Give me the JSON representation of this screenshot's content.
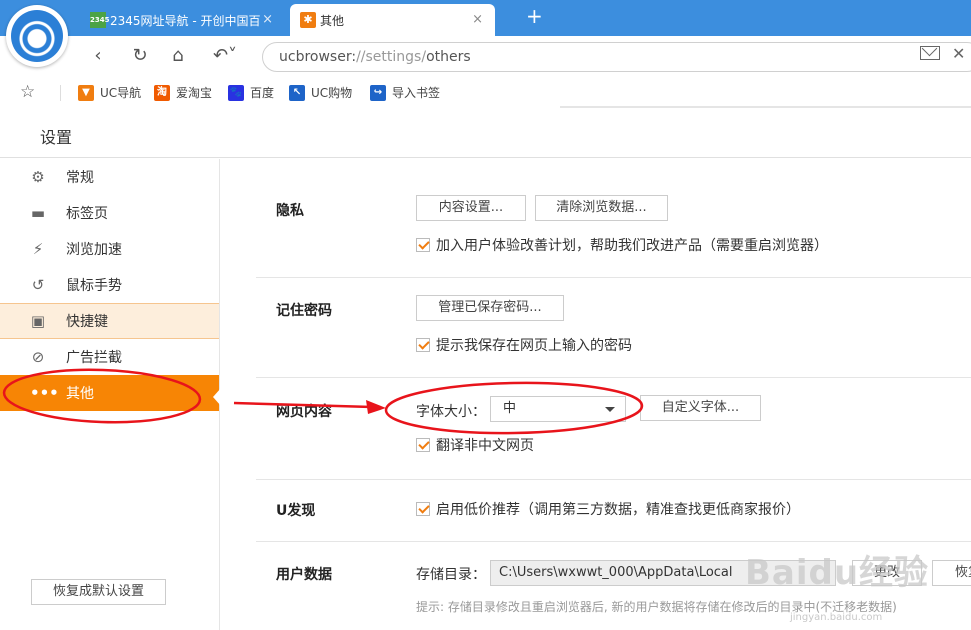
{
  "tabs": [
    {
      "label": "2345网址导航 - 开创中国百",
      "favicon": "2345-icon",
      "favicon_text": "2345"
    },
    {
      "label": "其他",
      "favicon": "gear-icon"
    }
  ],
  "tab_close": "×",
  "new_tab": "+",
  "address": {
    "scheme": "ucbrowser:",
    "sep1": "//",
    "host": "settings",
    "sep2": "/",
    "path": "others"
  },
  "bookmarks": [
    {
      "label": "UC导航",
      "color": "#f07d10",
      "glyph": "▼"
    },
    {
      "label": "爱淘宝",
      "color": "#f05a00",
      "glyph": "淘"
    },
    {
      "label": "百度",
      "color": "#2932e1",
      "glyph": "🐾"
    },
    {
      "label": "UC购物",
      "color": "#1e64c8",
      "glyph": "↖"
    },
    {
      "label": "导入书签",
      "color": "#1e64c8",
      "glyph": "↪"
    }
  ],
  "settings_title": "设置",
  "sidebar": {
    "items": [
      {
        "label": "常规",
        "icon": "gear-icon",
        "glyph": "⚙"
      },
      {
        "label": "标签页",
        "icon": "tab-icon",
        "glyph": "▬"
      },
      {
        "label": "浏览加速",
        "icon": "lightning-icon",
        "glyph": "⚡"
      },
      {
        "label": "鼠标手势",
        "icon": "mouse-gesture-icon",
        "glyph": "↺"
      },
      {
        "label": "快捷键",
        "icon": "shortcut-icon",
        "glyph": "▣"
      },
      {
        "label": "广告拦截",
        "icon": "block-icon",
        "glyph": "⊘"
      },
      {
        "label": "其他",
        "icon": "more-icon",
        "glyph": "•••"
      }
    ],
    "reset_label": "恢复成默认设置"
  },
  "privacy": {
    "title": "隐私",
    "content_settings": "内容设置...",
    "clear_data": "清除浏览数据...",
    "ux_plan": "加入用户体验改善计划，帮助我们改进产品（需要重启浏览器）"
  },
  "passwords": {
    "title": "记住密码",
    "manage": "管理已保存密码...",
    "prompt_save": "提示我保存在网页上输入的密码"
  },
  "web_content": {
    "title": "网页内容",
    "font_size_label": "字体大小：",
    "font_size_value": "中",
    "custom_fonts": "自定义字体...",
    "translate": "翻译非中文网页"
  },
  "u_discover": {
    "title": "U发现",
    "low_price": "启用低价推荐（调用第三方数据，精准查找更低商家报价）"
  },
  "user_data": {
    "title": "用户数据",
    "dir_label": "存储目录：",
    "dir_value": "C:\\Users\\wxwwt_000\\AppData\\Local",
    "change": "更改",
    "restore": "恢复",
    "hint": "提示: 存储目录修改且重启浏览器后, 新的用户数据将存储在修改后的目录中(不迁移老数据)"
  },
  "watermark": {
    "main": "Baidu经验",
    "sub": "jingyan.baidu.com"
  },
  "colors": {
    "accent": "#f78505",
    "titlebar": "#3c8ede",
    "annotation": "#e8141b"
  }
}
